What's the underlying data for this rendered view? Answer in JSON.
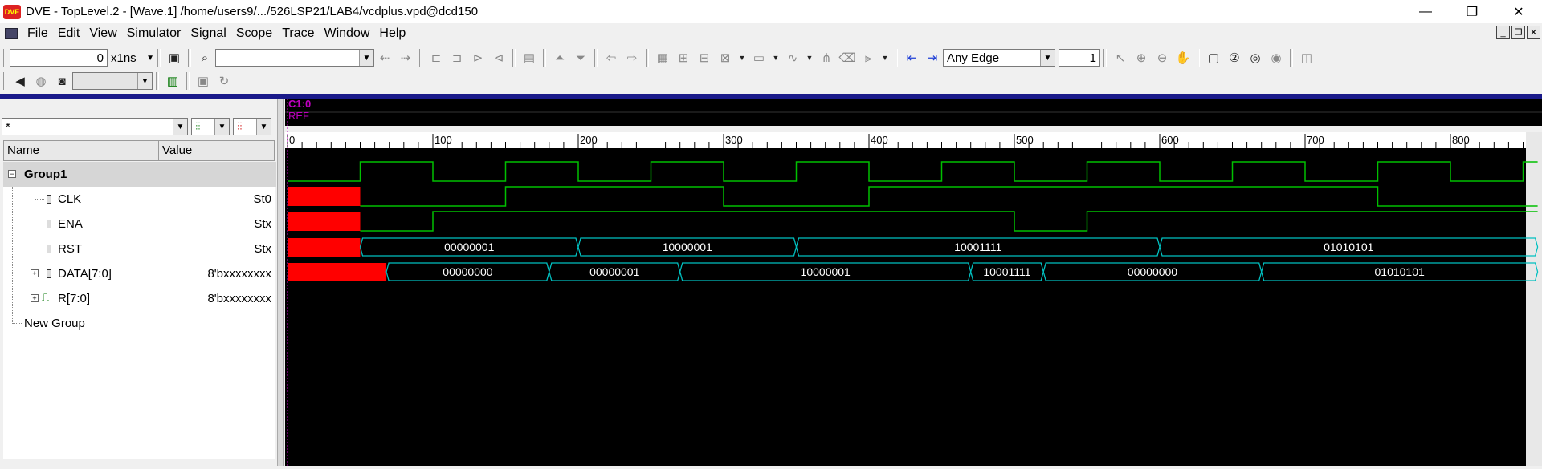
{
  "window": {
    "title": "DVE - TopLevel.2 - [Wave.1]  /home/users9/.../526LSP21/LAB4/vcdplus.vpd@dcd150",
    "logo": "DVE",
    "controls": [
      "—",
      "❐",
      "✕"
    ]
  },
  "menu": [
    "File",
    "Edit",
    "View",
    "Simulator",
    "Signal",
    "Scope",
    "Trace",
    "Window",
    "Help"
  ],
  "mdi_controls": [
    "_",
    "❐",
    "✕"
  ],
  "toolbar": {
    "time_value": "0",
    "time_unit": "x1ns",
    "search_value": "",
    "edge_type": "Any Edge",
    "edge_count": "1"
  },
  "filter": {
    "value": "*"
  },
  "columns": {
    "name": "Name",
    "value": "Value"
  },
  "cursor": {
    "label": "C1:0",
    "ref": "REF"
  },
  "groups": [
    {
      "name": "Group1"
    },
    {
      "name": "New Group"
    }
  ],
  "signals": [
    {
      "name": "CLK",
      "value": "St0"
    },
    {
      "name": "ENA",
      "value": "Stx"
    },
    {
      "name": "RST",
      "value": "Stx"
    },
    {
      "name": "DATA[7:0]",
      "value": "8'bxxxxxxxx"
    },
    {
      "name": "R[7:0]",
      "value": "8'bxxxxxxxx"
    }
  ],
  "timeline": {
    "ticks": [
      "0",
      "100",
      "200",
      "300",
      "400",
      "500",
      "600",
      "700",
      "800"
    ]
  },
  "waves": {
    "clk_period": 100,
    "clk_rise_first": 50,
    "ena_transitions": [
      [
        0,
        "x"
      ],
      [
        50,
        0
      ],
      [
        150,
        1
      ],
      [
        300,
        0
      ],
      [
        400,
        1
      ],
      [
        750,
        0
      ]
    ],
    "rst_transitions": [
      [
        0,
        "x"
      ],
      [
        50,
        0
      ],
      [
        100,
        1
      ],
      [
        500,
        0
      ],
      [
        550,
        1
      ]
    ],
    "data_segments": [
      {
        "start": 0,
        "end": 50,
        "value": "x"
      },
      {
        "start": 50,
        "end": 200,
        "value": "00000001"
      },
      {
        "start": 200,
        "end": 350,
        "value": "10000001"
      },
      {
        "start": 350,
        "end": 600,
        "value": "10001111"
      },
      {
        "start": 600,
        "end": 860,
        "value": "01010101"
      }
    ],
    "r_segments": [
      {
        "start": 0,
        "end": 68,
        "value": "x"
      },
      {
        "start": 68,
        "end": 180,
        "value": "00000000"
      },
      {
        "start": 180,
        "end": 270,
        "value": "00000001"
      },
      {
        "start": 270,
        "end": 470,
        "value": "10000001"
      },
      {
        "start": 470,
        "end": 520,
        "value": "10001111"
      },
      {
        "start": 520,
        "end": 670,
        "value": "00000000"
      },
      {
        "start": 670,
        "end": 860,
        "value": "01010101"
      }
    ],
    "colors": {
      "clk": "#00c000",
      "ena": "#00c000",
      "rst": "#00c000",
      "bus": "#00c0c0",
      "unknown": "#ff0000",
      "cursor": "#c000c0",
      "text": "#ffffff"
    }
  }
}
